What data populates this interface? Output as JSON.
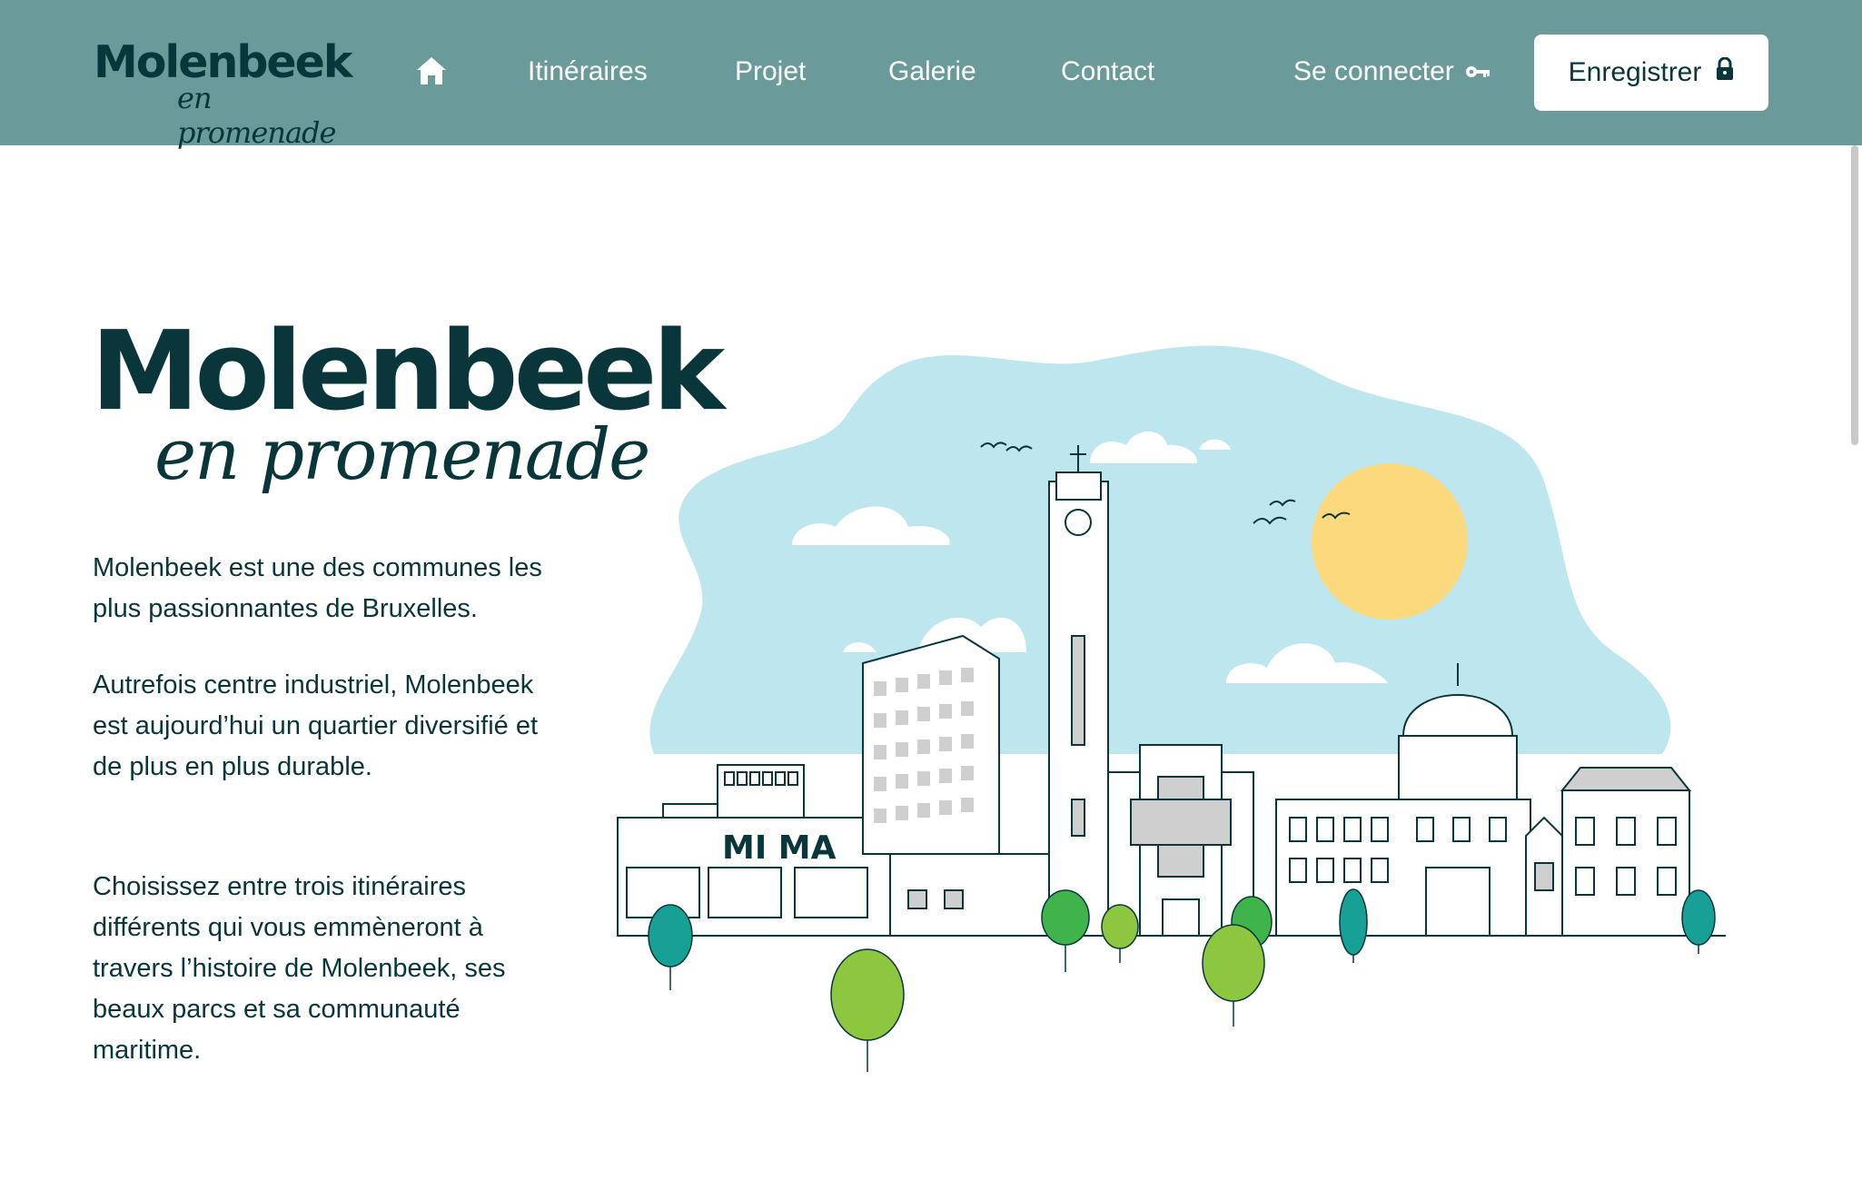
{
  "header": {
    "logo": {
      "brand": "Molenbeek",
      "tagline": "en promenade"
    },
    "nav": {
      "home_icon": "home-icon",
      "items": [
        {
          "label": "Itinéraires"
        },
        {
          "label": "Projet"
        },
        {
          "label": "Galerie"
        },
        {
          "label": "Contact"
        }
      ]
    },
    "login_label": "Se connecter",
    "login_icon": "key-icon",
    "register_label": "Enregistrer",
    "register_icon": "lock-icon"
  },
  "hero": {
    "brand": "Molenbeek",
    "tagline": "en promenade",
    "paragraphs": [
      "Molenbeek est une des communes les plus passionnantes de Bruxelles.",
      "Autrefois centre industriel, Molenbeek est aujourd’hui un quartier diversifié et de plus en plus durable.",
      "Choisissez entre trois itinéraires différents qui vous emmèneront à travers l’histoire de Molenbeek, ses beaux parcs et sa communauté maritime."
    ],
    "illustration": {
      "museum_sign": "MI MA"
    }
  },
  "colors": {
    "header_bg": "#6a9b9a",
    "text_dark": "#08363a",
    "sky": "#bde6ee",
    "sun": "#fcd97c",
    "tree_green": "#8dc63f",
    "tree_teal": "#17a096"
  }
}
